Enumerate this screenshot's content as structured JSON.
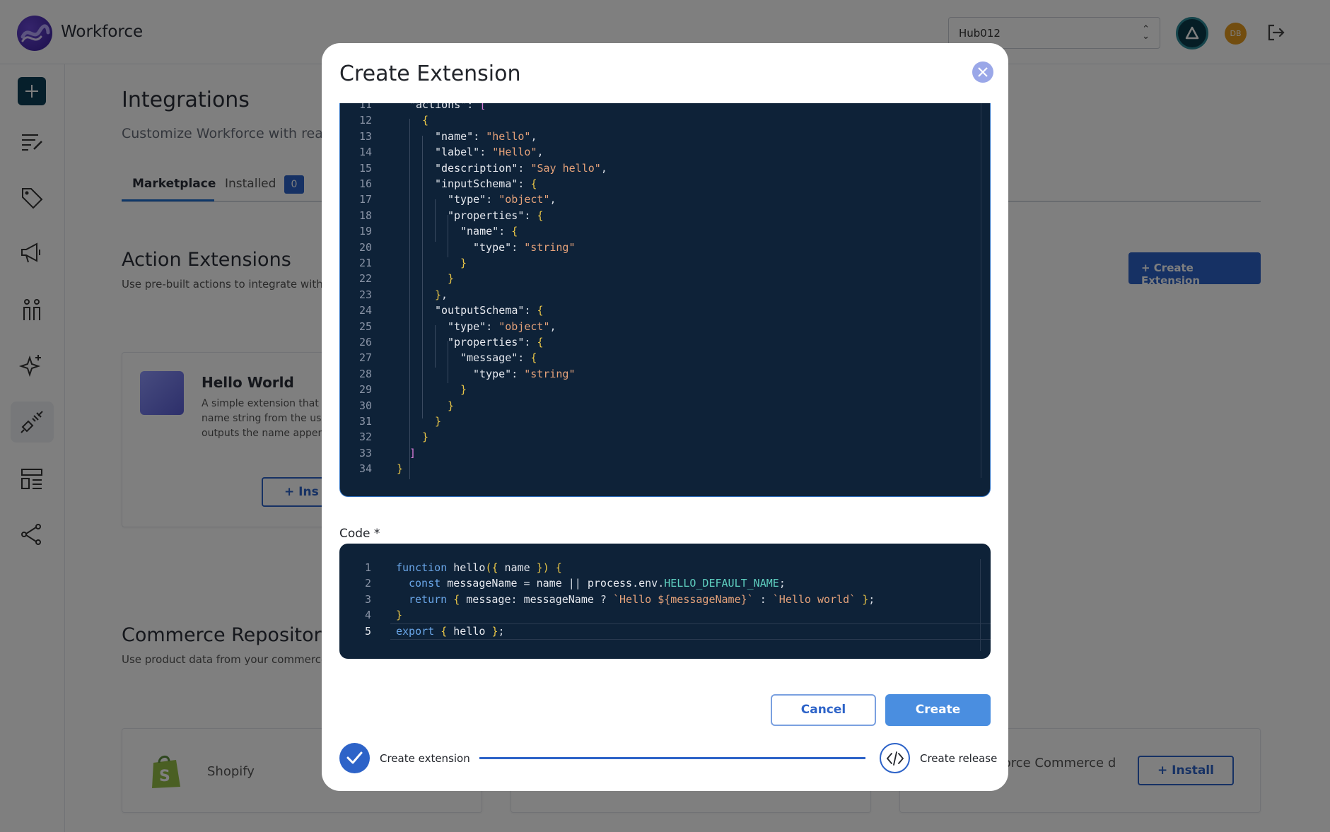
{
  "app": {
    "brand": "Workforce",
    "hub": "Hub012",
    "user_initials": "DB"
  },
  "page": {
    "title": "Integrations",
    "subtitle": "Customize Workforce with ready",
    "tabs": {
      "marketplace": "Marketplace",
      "installed": "Installed",
      "installed_count": "0"
    }
  },
  "sections": {
    "actions_title": "Action Extensions",
    "actions_sub": "Use pre-built actions to integrate with exte",
    "create_extension_btn": "+ Create Extension",
    "hello_world": {
      "name": "Hello World",
      "description": "A simple extension that ta name string from the user outputs the name append",
      "install": "+ Ins"
    },
    "commerce_title": "Commerce Repositorie",
    "commerce_sub": "Use product data from your commerce pla",
    "shopify": "Shopify",
    "sfcc": "sforce Commerce d",
    "install_btn": "+ Install"
  },
  "modal": {
    "title": "Create Extension",
    "code_label": "Code *",
    "cancel": "Cancel",
    "create": "Create",
    "steps": {
      "step1": "Create extension",
      "step2": "Create release"
    }
  },
  "manifest_lines": [
    {
      "n": "11",
      "t": "\"actions\": ["
    },
    {
      "n": "12",
      "t": "{"
    },
    {
      "n": "13",
      "t": "\"name\": \"hello\","
    },
    {
      "n": "14",
      "t": "\"label\": \"Hello\","
    },
    {
      "n": "15",
      "t": "\"description\": \"Say hello\","
    },
    {
      "n": "16",
      "t": "\"inputSchema\": {"
    },
    {
      "n": "17",
      "t": "\"type\": \"object\","
    },
    {
      "n": "18",
      "t": "\"properties\": {"
    },
    {
      "n": "19",
      "t": "\"name\": {"
    },
    {
      "n": "20",
      "t": "\"type\": \"string\""
    },
    {
      "n": "21",
      "t": "}"
    },
    {
      "n": "22",
      "t": "}"
    },
    {
      "n": "23",
      "t": "},"
    },
    {
      "n": "24",
      "t": "\"outputSchema\": {"
    },
    {
      "n": "25",
      "t": "\"type\": \"object\","
    },
    {
      "n": "26",
      "t": "\"properties\": {"
    },
    {
      "n": "27",
      "t": "\"message\": {"
    },
    {
      "n": "28",
      "t": "\"type\": \"string\""
    },
    {
      "n": "29",
      "t": "}"
    },
    {
      "n": "30",
      "t": "}"
    },
    {
      "n": "31",
      "t": "}"
    },
    {
      "n": "32",
      "t": "}"
    },
    {
      "n": "33",
      "t": "]"
    },
    {
      "n": "34",
      "t": "}"
    }
  ],
  "code_lines": [
    {
      "n": "1",
      "t": "function hello({ name }) {"
    },
    {
      "n": "2",
      "t": "const messageName = name || process.env.HELLO_DEFAULT_NAME;"
    },
    {
      "n": "3",
      "t": "return { message: messageName ? `Hello ${messageName}` : `Hello world` };"
    },
    {
      "n": "4",
      "t": "}"
    },
    {
      "n": "5",
      "t": "export { hello };"
    }
  ]
}
